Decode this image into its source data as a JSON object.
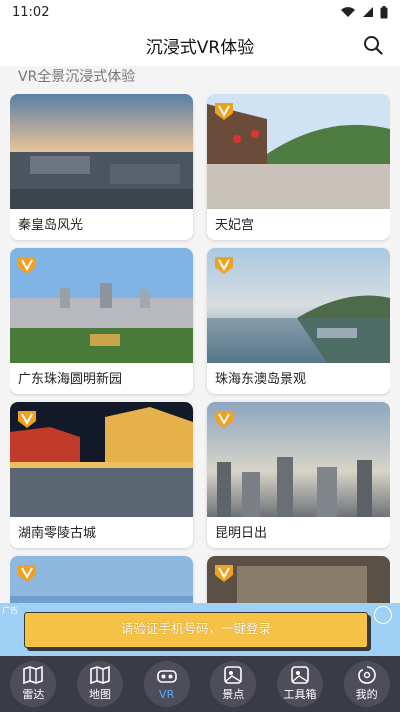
{
  "status": {
    "time": "11:02"
  },
  "header": {
    "title": "沉浸式VR体验"
  },
  "section": {
    "title": "VR全景沉浸式体验"
  },
  "cards": [
    {
      "label": "秦皇岛风光",
      "vr_badge": false
    },
    {
      "label": "天妃宫",
      "vr_badge": true
    },
    {
      "label": "广东珠海圆明新园",
      "vr_badge": true
    },
    {
      "label": "珠海东澳岛景观",
      "vr_badge": true
    },
    {
      "label": "湖南零陵古城",
      "vr_badge": true
    },
    {
      "label": "昆明日出",
      "vr_badge": true
    }
  ],
  "promo": {
    "text": "请验证手机号码，一键登录",
    "small_text": "广告"
  },
  "tabs": [
    {
      "label": "雷达",
      "icon": "map-icon"
    },
    {
      "label": "地图",
      "icon": "map-icon"
    },
    {
      "label": "VR",
      "icon": "vr-icon",
      "active": true
    },
    {
      "label": "景点",
      "icon": "scenic-icon"
    },
    {
      "label": "工具箱",
      "icon": "toolbox-icon"
    },
    {
      "label": "我的",
      "icon": "profile-icon"
    }
  ],
  "colors": {
    "accent": "#5aa8ff",
    "tabbar": "#3b3b45",
    "promo_bg": "#9fd0f5",
    "promo_btn": "#f6c245"
  }
}
